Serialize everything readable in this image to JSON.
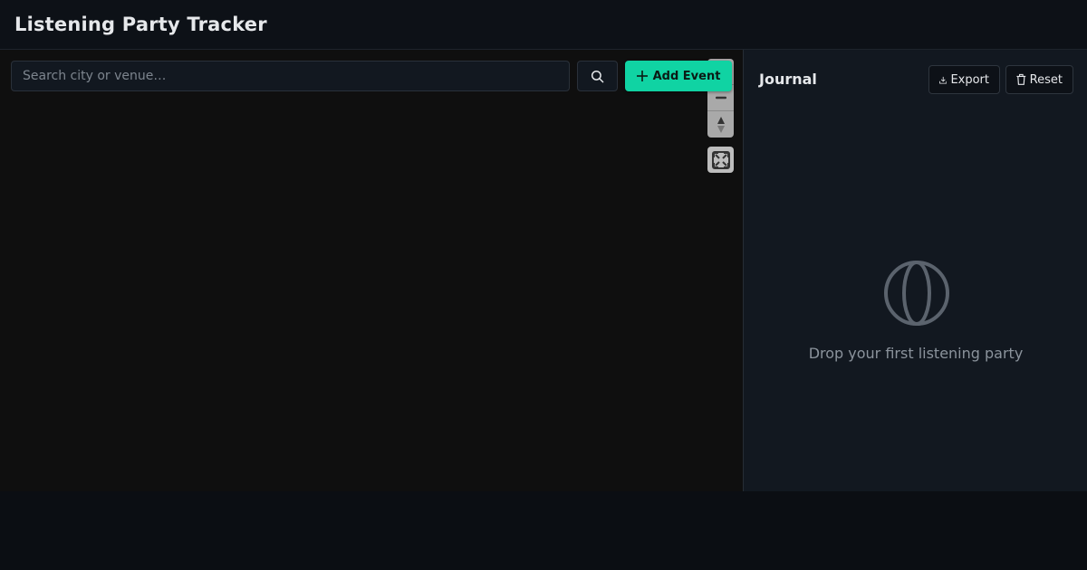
{
  "header": {
    "title": "Listening Party Tracker"
  },
  "map": {
    "search": {
      "placeholder": "Search city or venue…",
      "value": ""
    },
    "search_button_icon": "search-icon",
    "add_event_label": "Add Event",
    "controls": [
      "zoom-in",
      "zoom-out",
      "compass-reset",
      "fullscreen"
    ]
  },
  "journal": {
    "title": "Journal",
    "export_label": "Export",
    "reset_label": "Reset",
    "empty_message": "Drop your first listening party"
  },
  "colors": {
    "accent": "#10d3a3",
    "background": "#0b0e13",
    "panel": "#121820"
  }
}
